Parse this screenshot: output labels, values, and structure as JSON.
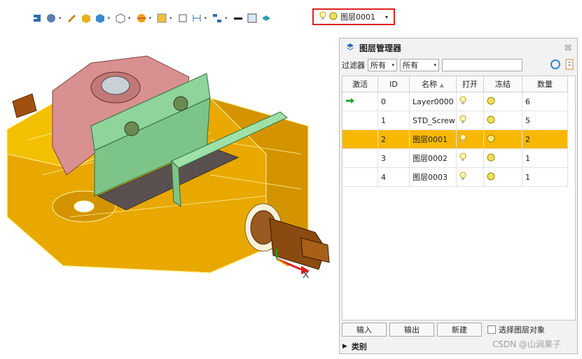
{
  "toolbar": {
    "icons": [
      "import-icon",
      "display-mode-icon",
      "pencil-icon",
      "shaded-cube-icon",
      "solid-cube-icon",
      "wireframe-cube-icon",
      "section-view-icon",
      "render-icon",
      "fit-view-icon",
      "dimension-icon",
      "hierarchy-icon",
      "line-style-icon",
      "color-swatch-icon",
      "material-icon"
    ]
  },
  "layer_combo": {
    "current_layer": "图层0001"
  },
  "panel": {
    "title": "图层管理器",
    "close_label": "☒",
    "filter_label": "过滤器",
    "filter_1": "所有",
    "filter_2": "所有",
    "columns": [
      "激活",
      "ID",
      "名称",
      "打开",
      "冻结",
      "数量"
    ],
    "rows": [
      {
        "active": true,
        "id": "0",
        "name": "Layer0000",
        "count": "6",
        "selected": false,
        "freeze_fill": "#f0e060"
      },
      {
        "active": false,
        "id": "1",
        "name": "STD_Screw",
        "count": "5",
        "selected": false,
        "freeze_fill": "#f0e060"
      },
      {
        "active": false,
        "id": "2",
        "name": "图层0001",
        "count": "2",
        "selected": true,
        "freeze_fill": "#f8e880"
      },
      {
        "active": false,
        "id": "3",
        "name": "图层0002",
        "count": "1",
        "selected": false,
        "freeze_fill": "#f0e060"
      },
      {
        "active": false,
        "id": "4",
        "name": "图层0003",
        "count": "1",
        "selected": false,
        "freeze_fill": "#f0e060"
      }
    ],
    "buttons": {
      "import": "输入",
      "export": "输出",
      "new": "新建"
    },
    "select_layer_objects": "选择图层对象",
    "category": "类别"
  },
  "axis_label": "X",
  "watermark": "CSDN @山涧果子",
  "colors": {
    "selection": "#f8b800",
    "accent_red": "#e02020",
    "part_gold": "#e8a800",
    "jaw_green": "#8fd49a",
    "clamp_pink": "#d89090"
  }
}
